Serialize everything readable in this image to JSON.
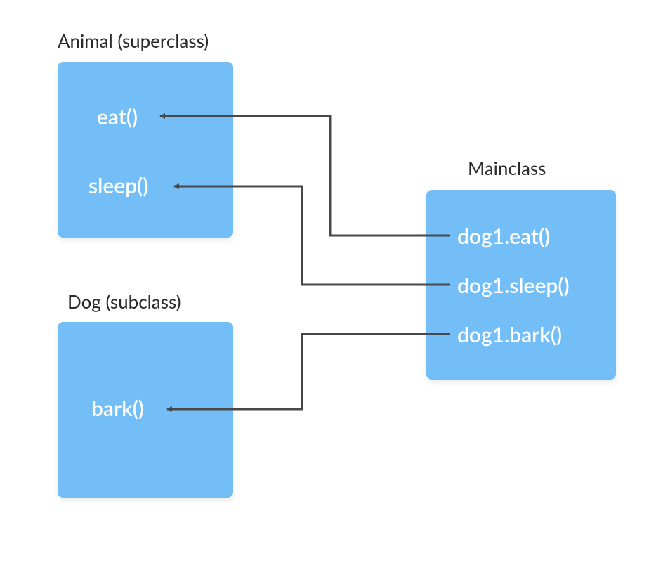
{
  "superclass": {
    "label": "Animal (superclass)",
    "methods": [
      "eat()",
      "sleep()"
    ]
  },
  "subclass": {
    "label": "Dog (subclass)",
    "methods": [
      "bark()"
    ]
  },
  "mainclass": {
    "label": "Mainclass",
    "calls": [
      "dog1.eat()",
      "dog1.sleep()",
      "dog1.bark()"
    ]
  },
  "colors": {
    "box": "#73bef7",
    "arrow": "#484848"
  }
}
